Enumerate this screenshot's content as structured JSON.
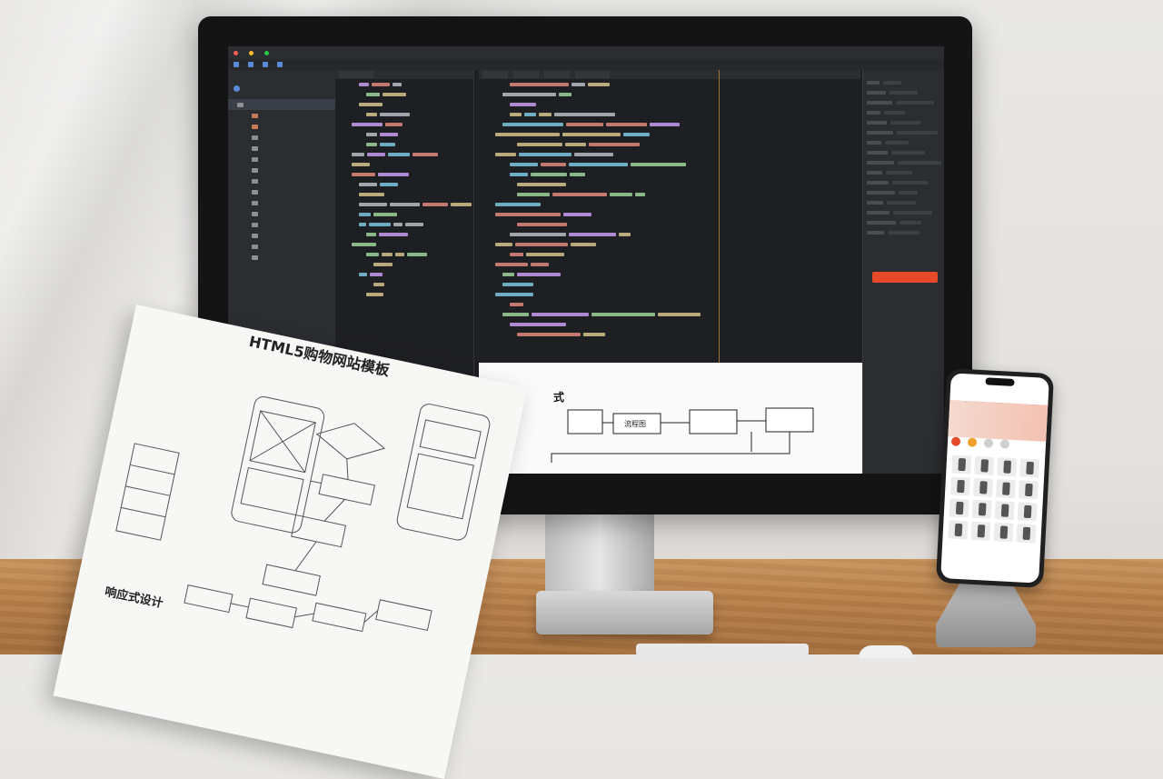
{
  "scene": {
    "description_colors": {
      "accent": "#e8492a",
      "ide_bg": "#1e1f22"
    }
  },
  "paper": {
    "title": "HTML5购物网站模板",
    "section_title": "响应式设计"
  },
  "monitor": {
    "screen_caption_fragment": "式"
  },
  "flowchart": {
    "boxes": [
      "流程图"
    ]
  }
}
